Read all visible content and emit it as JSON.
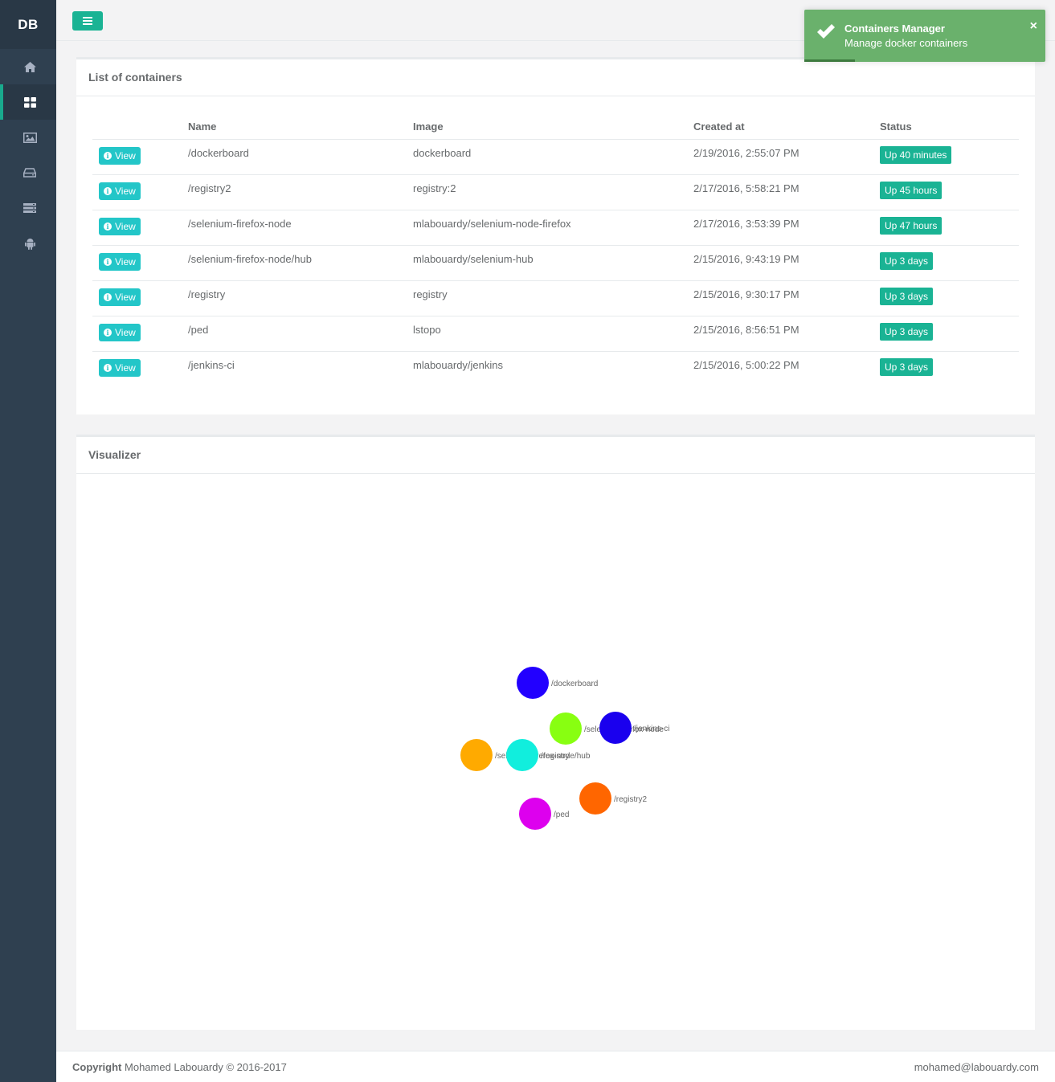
{
  "brand": "DB",
  "sidebar": {
    "items": [
      {
        "icon": "home-icon"
      },
      {
        "icon": "dashboard-icon",
        "active": true
      },
      {
        "icon": "image-icon"
      },
      {
        "icon": "hdd-icon"
      },
      {
        "icon": "server-icon"
      },
      {
        "icon": "android-icon"
      }
    ]
  },
  "list_panel": {
    "title": "List of containers",
    "columns": [
      "",
      "Name",
      "Image",
      "Created at",
      "Status"
    ],
    "view_label": "View",
    "rows": [
      {
        "name": "/dockerboard",
        "image": "dockerboard",
        "created": "2/19/2016, 2:55:07 PM",
        "status": "Up 40 minutes"
      },
      {
        "name": "/registry2",
        "image": "registry:2",
        "created": "2/17/2016, 5:58:21 PM",
        "status": "Up 45 hours"
      },
      {
        "name": "/selenium-firefox-node",
        "image": "mlabouardy/selenium-node-firefox",
        "created": "2/17/2016, 3:53:39 PM",
        "status": "Up 47 hours"
      },
      {
        "name": "/selenium-firefox-node/hub",
        "image": "mlabouardy/selenium-hub",
        "created": "2/15/2016, 9:43:19 PM",
        "status": "Up 3 days"
      },
      {
        "name": "/registry",
        "image": "registry",
        "created": "2/15/2016, 9:30:17 PM",
        "status": "Up 3 days"
      },
      {
        "name": "/ped",
        "image": "lstopo",
        "created": "2/15/2016, 8:56:51 PM",
        "status": "Up 3 days"
      },
      {
        "name": "/jenkins-ci",
        "image": "mlabouardy/jenkins",
        "created": "2/15/2016, 5:00:22 PM",
        "status": "Up 3 days"
      }
    ]
  },
  "visualizer": {
    "title": "Visualizer",
    "nodes": [
      {
        "label": "/dockerboard",
        "color": "#2200ff"
      },
      {
        "label": "/selenium-firefox-node",
        "color": "#88ff11"
      },
      {
        "label": "/jenkins-ci",
        "color": "#1a00ee"
      },
      {
        "label": "/selenium-firefox-node/hub",
        "color": "#ffaa00"
      },
      {
        "label": "/registry",
        "color": "#11eedd"
      },
      {
        "label": "/registry2",
        "color": "#ff6600"
      },
      {
        "label": "/ped",
        "color": "#dd00ee"
      }
    ]
  },
  "footer": {
    "copyright_label": "Copyright",
    "copyright_text": "Mohamed Labouardy © 2016-2017",
    "email": "mohamed@labouardy.com"
  },
  "toast": {
    "title": "Containers Manager",
    "message": "Manage docker containers",
    "close": "×",
    "progress": 0.21
  },
  "colors": {
    "sidebar": "#2f4050",
    "accent": "#1ab394",
    "info": "#23c6c8",
    "toast": "#6ab16c"
  }
}
